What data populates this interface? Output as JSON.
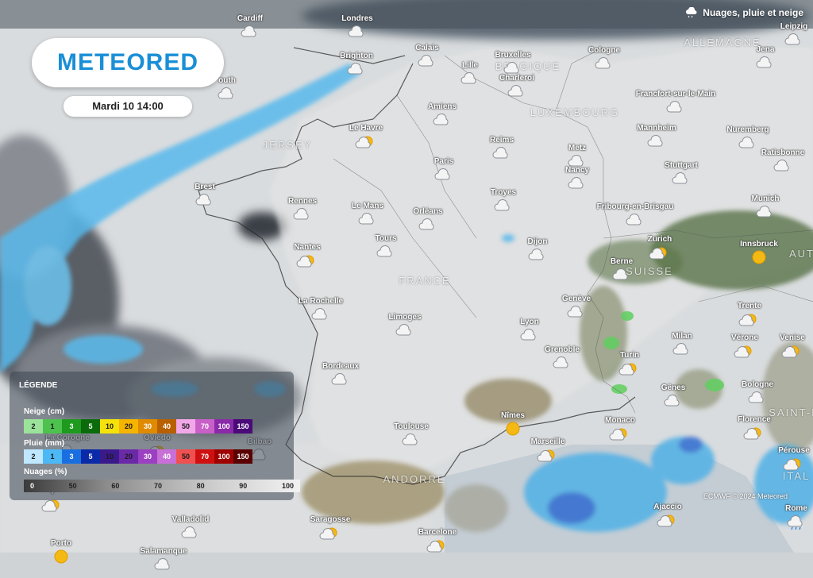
{
  "header": {
    "layer_title": "Nuages, pluie et neige"
  },
  "brand": {
    "logo": "METEORED",
    "accent": "#1a8fd6"
  },
  "date_label": "Mardi 10 14:00",
  "countries": [
    {
      "label": "ALLEMAGNE"
    },
    {
      "label": "BELGIQUE"
    },
    {
      "label": "LUXEMBOURG"
    },
    {
      "label": "FRANCE"
    },
    {
      "label": "SUISSE"
    },
    {
      "label": "JERSEY"
    },
    {
      "label": "ANDORRE"
    },
    {
      "label": "AUT"
    },
    {
      "label": "ITAL"
    },
    {
      "label": "SAINT-MA"
    }
  ],
  "cities": [
    {
      "name": "Cardiff",
      "icon": "cloud-icon"
    },
    {
      "name": "Londres",
      "icon": "cloud-icon"
    },
    {
      "name": "Leipzig",
      "icon": "cloud-icon"
    },
    {
      "name": "Brighton",
      "icon": "cloud-icon"
    },
    {
      "name": "Calais",
      "icon": "cloud-icon"
    },
    {
      "name": "Bruxelles",
      "icon": "cloud-icon"
    },
    {
      "name": "Lille",
      "icon": "cloud-icon"
    },
    {
      "name": "Charleroi",
      "icon": "cloud-icon"
    },
    {
      "name": "Cologne",
      "icon": "cloud-icon"
    },
    {
      "name": "Jena",
      "icon": "cloud-icon"
    },
    {
      "name": "outh",
      "icon": "cloud-icon"
    },
    {
      "name": "Amiens",
      "icon": "cloud-icon"
    },
    {
      "name": "Francfort-sur-le-Main",
      "icon": "cloud-icon"
    },
    {
      "name": "Le Havre",
      "icon": "cloud-sun-icon"
    },
    {
      "name": "Reims",
      "icon": "cloud-icon"
    },
    {
      "name": "Mannheim",
      "icon": "cloud-icon"
    },
    {
      "name": "Nuremberg",
      "icon": "cloud-icon"
    },
    {
      "name": "Metz",
      "icon": "cloud-icon"
    },
    {
      "name": "Ratisbonne",
      "icon": "cloud-icon"
    },
    {
      "name": "Paris",
      "icon": "cloud-icon"
    },
    {
      "name": "Stuttgart",
      "icon": "cloud-icon"
    },
    {
      "name": "Nancy",
      "icon": "cloud-icon"
    },
    {
      "name": "Brest",
      "icon": "cloud-icon"
    },
    {
      "name": "Rennes",
      "icon": "cloud-icon"
    },
    {
      "name": "Le Mans",
      "icon": "cloud-icon"
    },
    {
      "name": "Orléans",
      "icon": "cloud-icon"
    },
    {
      "name": "Troyes",
      "icon": "cloud-icon"
    },
    {
      "name": "Fribourg-en-Brisgau",
      "icon": "cloud-icon"
    },
    {
      "name": "Munich",
      "icon": "cloud-icon"
    },
    {
      "name": "Tours",
      "icon": "cloud-icon"
    },
    {
      "name": "Dijon",
      "icon": "cloud-icon"
    },
    {
      "name": "Zurich",
      "icon": "cloud-sun-icon"
    },
    {
      "name": "Innsbruck",
      "icon": "sun-icon"
    },
    {
      "name": "Nantes",
      "icon": "cloud-sun-icon"
    },
    {
      "name": "Berne",
      "icon": "cloud-icon"
    },
    {
      "name": "La Rochelle",
      "icon": "cloud-icon"
    },
    {
      "name": "Genève",
      "icon": "cloud-icon"
    },
    {
      "name": "Trente",
      "icon": "cloud-sun-icon"
    },
    {
      "name": "Limoges",
      "icon": "cloud-icon"
    },
    {
      "name": "Lyon",
      "icon": "cloud-icon"
    },
    {
      "name": "Milan",
      "icon": "cloud-icon"
    },
    {
      "name": "Vérone",
      "icon": "cloud-sun-icon"
    },
    {
      "name": "Venise",
      "icon": "cloud-sun-icon"
    },
    {
      "name": "Grenoble",
      "icon": "cloud-icon"
    },
    {
      "name": "Turin",
      "icon": "cloud-sun-icon"
    },
    {
      "name": "Bordeaux",
      "icon": "cloud-icon"
    },
    {
      "name": "Bologne",
      "icon": "cloud-icon"
    },
    {
      "name": "Gênes",
      "icon": "cloud-icon"
    },
    {
      "name": "Nîmes",
      "icon": "sun-icon"
    },
    {
      "name": "Florence",
      "icon": "cloud-sun-icon"
    },
    {
      "name": "Monaco",
      "icon": "cloud-sun-icon"
    },
    {
      "name": "Toulouse",
      "icon": "cloud-icon"
    },
    {
      "name": "Marseille",
      "icon": "cloud-sun-icon"
    },
    {
      "name": "Pérouse",
      "icon": "cloud-sun-icon"
    },
    {
      "name": "La Corogne",
      "icon": "cloud-icon"
    },
    {
      "name": "Oviedo",
      "icon": "cloud-sun-icon"
    },
    {
      "name": "Bilbao",
      "icon": "cloud-icon"
    },
    {
      "name": "Ajaccio",
      "icon": "cloud-sun-icon"
    },
    {
      "name": "Rome",
      "icon": "cloud-rain-icon"
    },
    {
      "name": "Saragosse",
      "icon": "cloud-sun-icon"
    },
    {
      "name": "Valladolid",
      "icon": "cloud-icon"
    },
    {
      "name": "Barcelone",
      "icon": "cloud-sun-icon"
    },
    {
      "name": "Porto",
      "icon": "sun-icon"
    },
    {
      "name": "Salamanque",
      "icon": "cloud-icon"
    },
    {
      "name": "V",
      "icon": "cloud-sun-icon"
    }
  ],
  "legend": {
    "title": "LÉGENDE",
    "snow": {
      "label": "Neige (cm)",
      "values": [
        "2",
        "1",
        "3",
        "5",
        "10",
        "20",
        "30",
        "40",
        "50",
        "70",
        "100",
        "150"
      ],
      "colors": [
        "#9be29b",
        "#4ec24e",
        "#1e9a1e",
        "#0b6b0b",
        "#f5e20a",
        "#f5b400",
        "#e08a00",
        "#b86000",
        "#f2a8e8",
        "#c860c8",
        "#8a2aa8",
        "#4a0a78"
      ]
    },
    "rain": {
      "label": "Pluie (mm)",
      "values": [
        "2",
        "1",
        "3",
        "5",
        "10",
        "20",
        "30",
        "40",
        "50",
        "70",
        "100",
        "150"
      ],
      "colors": [
        "#bfe7ff",
        "#4cb8f5",
        "#1a6fe0",
        "#0a2aa8",
        "#3a1a8a",
        "#6a2aa8",
        "#9a40c0",
        "#c870d8",
        "#f05050",
        "#d01010",
        "#a00000",
        "#5a0000"
      ]
    },
    "clouds": {
      "label": "Nuages (%)",
      "values": [
        "0",
        "50",
        "60",
        "70",
        "80",
        "90",
        "100"
      ]
    }
  },
  "attribution": "ECMWF © 2024 Meteored"
}
